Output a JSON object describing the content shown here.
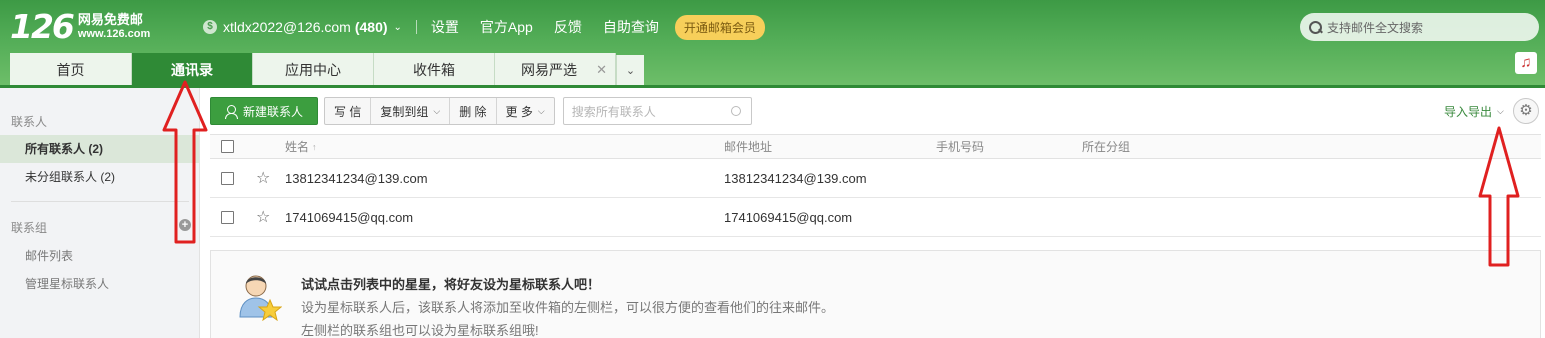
{
  "logo": {
    "number": "126",
    "name": "网易免费邮",
    "url": "www.126.com"
  },
  "account": {
    "icon": "coin-icon",
    "email": "xtldx2022@126.com",
    "unread": "(480)"
  },
  "topnav": [
    "设置",
    "官方App",
    "反馈",
    "自助查询"
  ],
  "vip_button": "开通邮箱会员",
  "search": {
    "placeholder": "支持邮件全文搜索"
  },
  "tabs": [
    {
      "label": "首页"
    },
    {
      "label": "通讯录",
      "active": true
    },
    {
      "label": "应用中心"
    },
    {
      "label": "收件箱"
    },
    {
      "label": "网易严选",
      "closable": true
    }
  ],
  "sidebar": {
    "contacts_title": "联系人",
    "all_contacts": "所有联系人 (2)",
    "ungrouped": "未分组联系人 (2)",
    "groups_title": "联系组",
    "mail_list": "邮件列表",
    "manage_starred": "管理星标联系人"
  },
  "toolbar": {
    "new_contact": "新建联系人",
    "write": "写 信",
    "copy_to_group": "复制到组",
    "delete": "删 除",
    "more": "更 多",
    "search_placeholder": "搜索所有联系人",
    "import_export": "导入导出"
  },
  "table": {
    "headers": {
      "name": "姓名",
      "email": "邮件地址",
      "phone": "手机号码",
      "group": "所在分组"
    },
    "rows": [
      {
        "name": "13812341234@139.com",
        "email": "13812341234@139.com",
        "phone": "",
        "group": ""
      },
      {
        "name": "1741069415@qq.com",
        "email": "1741069415@qq.com",
        "phone": "",
        "group": ""
      }
    ]
  },
  "tip": {
    "heading": "试试点击列表中的星星，将好友设为星标联系人吧！",
    "line1": "设为星标联系人后，该联系人将添加至收件箱的左侧栏，可以很方便的查看他们的往来邮件。",
    "line2": "左侧栏的联系组也可以设为星标联系组哦!"
  },
  "colors": {
    "brand_green": "#3c9e3f",
    "annotation_red": "#e02020",
    "vip_yellow": "#f7cf5a"
  }
}
